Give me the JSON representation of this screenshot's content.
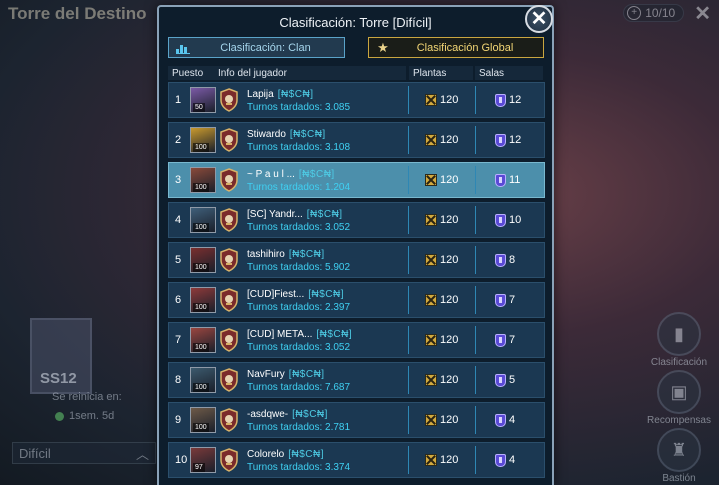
{
  "background": {
    "title": "Torre del Destino",
    "energy": "10/10",
    "season": "SS12",
    "reset_label": "Se reinicia en:",
    "reset_time": "1sem. 5d",
    "difficulty": "Difícil",
    "side_buttons": [
      "Clasificación",
      "Recompensas",
      "Bastión"
    ]
  },
  "modal": {
    "title": "Clasificación: Torre [Difícil]",
    "tabs": {
      "clan": "Clasificación: Clan",
      "global": "Clasificación Global"
    },
    "columns": {
      "rank": "Puesto",
      "player": "Info del jugador",
      "plants": "Plantas",
      "rooms": "Salas"
    },
    "turns_prefix": "Turnos tardados: ",
    "clan_tag": "[₦$C₦]",
    "rows": [
      {
        "rank": "1",
        "level": "50",
        "name": "Lapija",
        "turns": "3.085",
        "plants": "120",
        "rooms": "12",
        "avatar_color": "#7b5aa6",
        "selected": false
      },
      {
        "rank": "2",
        "level": "100",
        "name": "Stiwardo",
        "turns": "3.108",
        "plants": "120",
        "rooms": "12",
        "avatar_color": "#c99a2e",
        "selected": false
      },
      {
        "rank": "3",
        "level": "100",
        "name": "~ P a u l ...",
        "turns": "1.204",
        "plants": "120",
        "rooms": "11",
        "avatar_color": "#8a4a3a",
        "selected": true
      },
      {
        "rank": "4",
        "level": "100",
        "name": "[SC] Yandr...",
        "turns": "3.052",
        "plants": "120",
        "rooms": "10",
        "avatar_color": "#3f5f7a",
        "selected": false
      },
      {
        "rank": "5",
        "level": "100",
        "name": "tashihiro",
        "turns": "5.902",
        "plants": "120",
        "rooms": "8",
        "avatar_color": "#7a2f2f",
        "selected": false
      },
      {
        "rank": "6",
        "level": "100",
        "name": "[CUD]Fiest...",
        "turns": "2.397",
        "plants": "120",
        "rooms": "7",
        "avatar_color": "#8e3a3a",
        "selected": false
      },
      {
        "rank": "7",
        "level": "100",
        "name": "[CUD] META...",
        "turns": "3.052",
        "plants": "120",
        "rooms": "7",
        "avatar_color": "#9a4640",
        "selected": false
      },
      {
        "rank": "8",
        "level": "100",
        "name": "NavFury",
        "turns": "7.687",
        "plants": "120",
        "rooms": "5",
        "avatar_color": "#3c5a6e",
        "selected": false
      },
      {
        "rank": "9",
        "level": "100",
        "name": "-asdqwe-",
        "turns": "2.781",
        "plants": "120",
        "rooms": "4",
        "avatar_color": "#6e5a48",
        "selected": false
      },
      {
        "rank": "10",
        "level": "97",
        "name": "Colorelo",
        "turns": "3.374",
        "plants": "120",
        "rooms": "4",
        "avatar_color": "#7a3a3a",
        "selected": false
      }
    ]
  }
}
